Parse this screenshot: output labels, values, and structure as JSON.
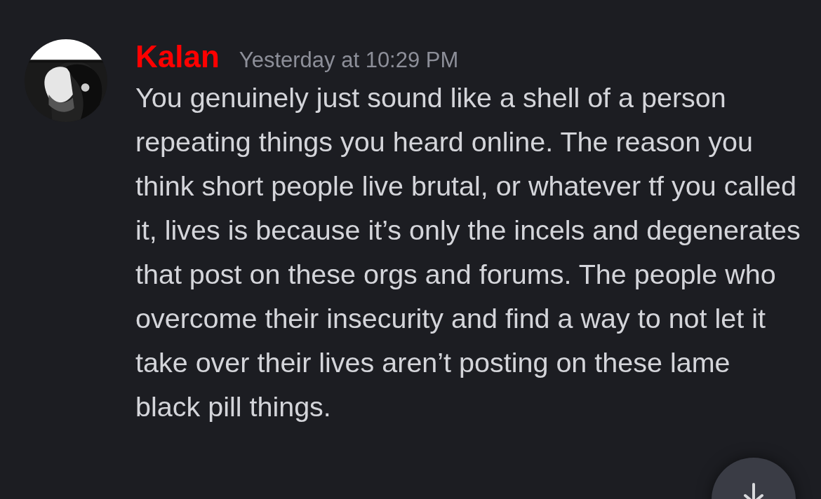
{
  "message": {
    "author": {
      "name": "Kalan",
      "color": "#ff0000"
    },
    "timestamp": "Yesterday at 10:29 PM",
    "text": "You genuinely just sound like a shell of a person repeating things you heard online. The reason you think short people live brutal, or whatever tf you called it, lives is because it’s only the incels and degenerates that post on these orgs and forums. The people who overcome their insecurity and find a way to not let it take over their lives aren’t posting on these lame black pill things."
  },
  "scroll_button": {
    "kind": "jump-down"
  }
}
